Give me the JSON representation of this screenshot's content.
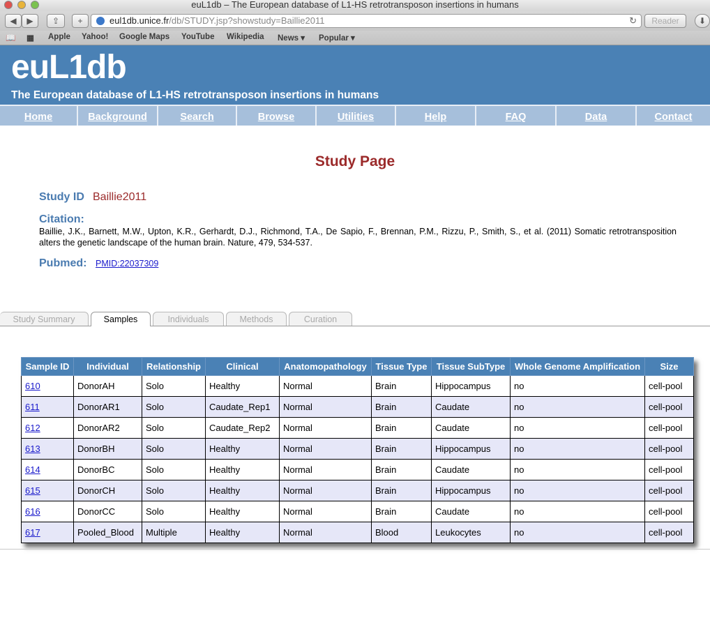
{
  "browser": {
    "window_title": "euL1db – The European database of L1-HS retrotransposon insertions in humans",
    "url_host": "eul1db.unice.fr",
    "url_path": "/db/STUDY.jsp?showstudy=Baillie2011",
    "reader_label": "Reader",
    "bookmarks": [
      "Apple",
      "Yahoo!",
      "Google Maps",
      "YouTube",
      "Wikipedia",
      "News ▾",
      "Popular ▾"
    ]
  },
  "site": {
    "logo": "euL1db",
    "tagline": "The European database of L1-HS retrotransposon insertions in humans",
    "nav": [
      "Home",
      "Background",
      "Search",
      "Browse",
      "Utilities",
      "Help",
      "FAQ",
      "Data",
      "Contact"
    ]
  },
  "study": {
    "page_title": "Study Page",
    "id_label": "Study ID",
    "id_value": "Baillie2011",
    "citation_label": "Citation:",
    "citation_text": "Baillie, J.K., Barnett, M.W., Upton, K.R., Gerhardt, D.J., Richmond, T.A., De Sapio, F., Brennan, P.M., Rizzu, P., Smith, S., et al. (2011) Somatic retrotransposition alters the genetic landscape of the human brain. Nature, 479, 534-537.",
    "pubmed_label": "Pubmed:",
    "pmid": "PMID:22037309"
  },
  "tabs": [
    "Study Summary",
    "Samples",
    "Individuals",
    "Methods",
    "Curation"
  ],
  "active_tab": "Samples",
  "table": {
    "headers": [
      "Sample ID",
      "Individual",
      "Relationship",
      "Clinical",
      "Anatomopathology",
      "Tissue Type",
      "Tissue SubType",
      "Whole Genome Amplification",
      "Size"
    ],
    "rows": [
      [
        "610",
        "DonorAH",
        "Solo",
        "Healthy",
        "Normal",
        "Brain",
        "Hippocampus",
        "no",
        "cell-pool"
      ],
      [
        "611",
        "DonorAR1",
        "Solo",
        "Caudate_Rep1",
        "Normal",
        "Brain",
        "Caudate",
        "no",
        "cell-pool"
      ],
      [
        "612",
        "DonorAR2",
        "Solo",
        "Caudate_Rep2",
        "Normal",
        "Brain",
        "Caudate",
        "no",
        "cell-pool"
      ],
      [
        "613",
        "DonorBH",
        "Solo",
        "Healthy",
        "Normal",
        "Brain",
        "Hippocampus",
        "no",
        "cell-pool"
      ],
      [
        "614",
        "DonorBC",
        "Solo",
        "Healthy",
        "Normal",
        "Brain",
        "Caudate",
        "no",
        "cell-pool"
      ],
      [
        "615",
        "DonorCH",
        "Solo",
        "Healthy",
        "Normal",
        "Brain",
        "Hippocampus",
        "no",
        "cell-pool"
      ],
      [
        "616",
        "DonorCC",
        "Solo",
        "Healthy",
        "Normal",
        "Brain",
        "Caudate",
        "no",
        "cell-pool"
      ],
      [
        "617",
        "Pooled_Blood",
        "Multiple",
        "Healthy",
        "Normal",
        "Blood",
        "Leukocytes",
        "no",
        "cell-pool"
      ]
    ]
  },
  "colors": {
    "header_blue": "#4a81b5",
    "nav_blue": "#a6bfdb",
    "title_red": "#9b2a2a",
    "row_alt": "#e6e7f8"
  }
}
